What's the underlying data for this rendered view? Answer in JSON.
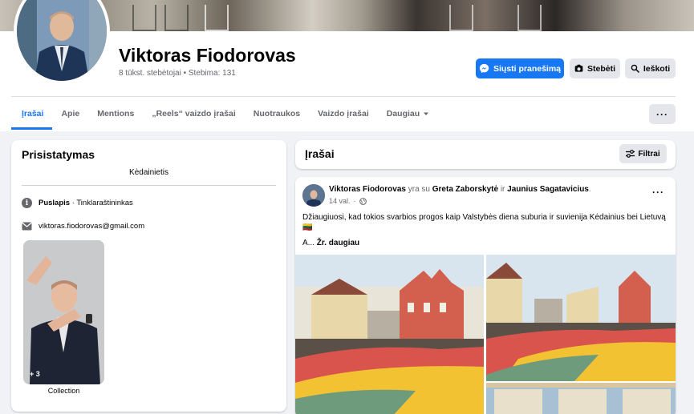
{
  "profile": {
    "name": "Viktoras Fiodorovas",
    "followers": "8 tūkst. stebėtojai",
    "following": "Stebima: 131"
  },
  "actions": {
    "message_label": "Siųsti pranešimą",
    "follow_label": "Stebėti",
    "search_label": "Ieškoti"
  },
  "tabs": [
    {
      "label": "Įrašai",
      "active": true
    },
    {
      "label": "Apie"
    },
    {
      "label": "Mentions"
    },
    {
      "label": "„Reels“ vaizdo įrašai"
    },
    {
      "label": "Nuotraukos"
    },
    {
      "label": "Vaizdo įrašai"
    },
    {
      "label": "Daugiau"
    }
  ],
  "more_menu_label": "···",
  "intro": {
    "title": "Prisistatymas",
    "bio": "Kėdainietis",
    "category_label": "Puslapis",
    "category_value": "Tinklaraštininkas",
    "email": "viktoras.fiodorovas@gmail.com",
    "collection_count": "+ 3",
    "collection_label": "Collection"
  },
  "posts": {
    "title": "Įrašai",
    "filter_label": "Filtrai"
  },
  "post": {
    "author": "Viktoras Fiodorovas",
    "with_text": "yra su",
    "tagged_1": "Greta Zaborskytė",
    "and_text": "ir",
    "tagged_2": "Jaunius Sagatavicius",
    "time": "14 val.",
    "text": "Džiaugiuosi, kad tokios svarbios progos kaip Valstybės diena suburia ir suvienija Kėdainius bei Lietuvą 🇱🇹",
    "more_prefix": "A...",
    "more_link": "Žr. daugiau"
  },
  "colors": {
    "accent": "#1877f2",
    "background": "#f0f2f5",
    "button_gray": "#e4e6eb",
    "flag_yellow": "#f2c233",
    "flag_green": "#6f9b7d",
    "flag_red": "#d9544d"
  }
}
